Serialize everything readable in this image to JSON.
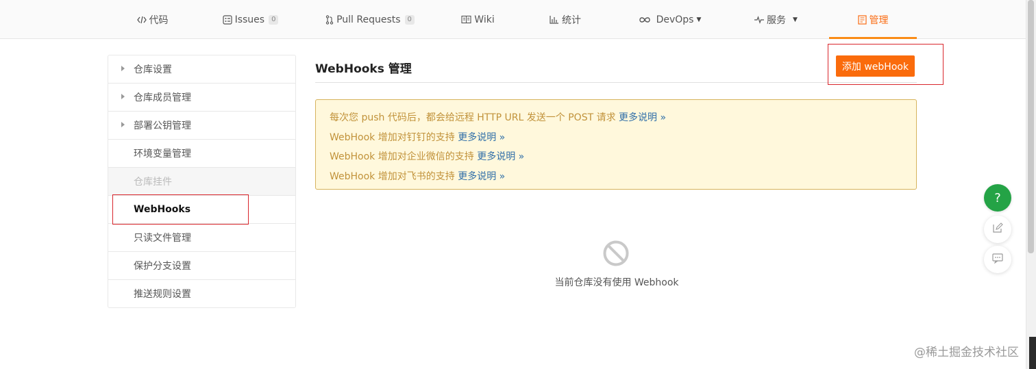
{
  "tabs": [
    {
      "label": "代码",
      "icon": "code-icon"
    },
    {
      "label": "Issues",
      "count": "0",
      "icon": "issues-icon"
    },
    {
      "label": "Pull Requests",
      "count": "0",
      "icon": "pull-request-icon"
    },
    {
      "label": "Wiki",
      "icon": "book-icon"
    },
    {
      "label": "统计",
      "icon": "bar-chart-icon"
    },
    {
      "label": "DevOps",
      "icon": "infinity-icon",
      "dropdown": true
    },
    {
      "label": "服务",
      "icon": "pulse-icon",
      "dropdown": true
    },
    {
      "label": "管理",
      "icon": "manage-icon",
      "active": true
    }
  ],
  "sidebar": {
    "items": [
      {
        "label": "仓库设置",
        "expandable": true
      },
      {
        "label": "仓库成员管理",
        "expandable": true
      },
      {
        "label": "部署公钥管理",
        "expandable": true
      },
      {
        "label": "环境变量管理"
      },
      {
        "label": "仓库挂件",
        "disabled": true
      },
      {
        "label": "WebHooks",
        "active": true
      },
      {
        "label": "只读文件管理"
      },
      {
        "label": "保护分支设置"
      },
      {
        "label": "推送规则设置"
      }
    ]
  },
  "main": {
    "title": "WebHooks 管理",
    "add_button": "添加 webHook",
    "notice": [
      {
        "text": "每次您 push 代码后，都会给远程 HTTP URL 发送一个 POST 请求",
        "link": "更多说明 »"
      },
      {
        "text": "WebHook 增加对钉钉的支持",
        "link": "更多说明 »"
      },
      {
        "text": "WebHook 增加对企业微信的支持",
        "link": "更多说明 »"
      },
      {
        "text": "WebHook 增加对飞书的支持",
        "link": "更多说明 »"
      }
    ],
    "empty_text": "当前仓库没有使用 Webhook"
  },
  "floating": {
    "help": "?"
  },
  "watermark": "@稀土掘金技术社区",
  "colors": {
    "accent": "#fa6b0c",
    "highlight_box": "#d9252b",
    "notice_bg": "#fff8dc",
    "notice_text": "#c1923a",
    "link": "#2f6ea8",
    "help_fab": "#24a346"
  }
}
